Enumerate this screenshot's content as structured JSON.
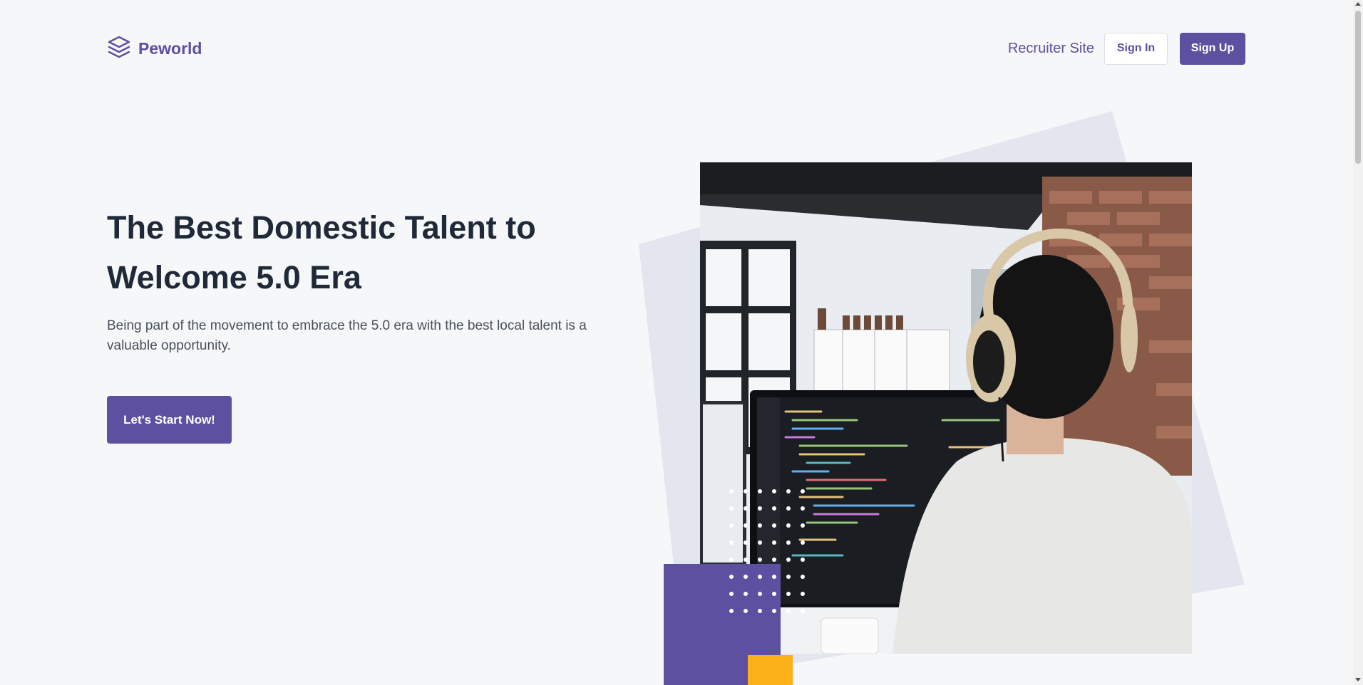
{
  "brand": {
    "name": "Peworld",
    "icon": "layers-icon",
    "color": "#5e50a1"
  },
  "nav": {
    "recruiter_label": "Recruiter Site",
    "signin_label": "Sign In",
    "signup_label": "Sign Up"
  },
  "hero": {
    "title": "The Best Domestic Talent to Welcome 5.0 Era",
    "description": "Being part of the movement to embrace the 5.0 era with the best local talent is a valuable opportunity.",
    "cta_label": "Let's Start Now!",
    "image": "developer-with-headphones-coding-photo"
  },
  "colors": {
    "accent": "#5e50a1",
    "yellow": "#fbb017",
    "background": "#f6f7f8"
  }
}
